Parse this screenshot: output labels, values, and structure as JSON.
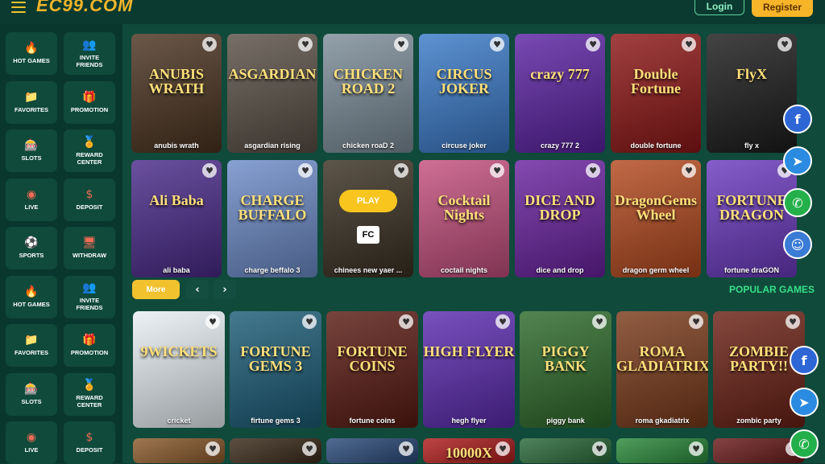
{
  "header": {
    "logo_text": "EC99.COM",
    "login_label": "Login",
    "register_label": "Register"
  },
  "sidebar": {
    "items": [
      {
        "label": "HOT GAMES",
        "icon": "fire-icon",
        "glyph": "🔥"
      },
      {
        "label": "INVITE FRIENDS",
        "icon": "users-icon",
        "glyph": "👥"
      },
      {
        "label": "FAVORITES",
        "icon": "folder-icon",
        "glyph": "📁"
      },
      {
        "label": "PROMOTION",
        "icon": "gift-icon",
        "glyph": "🎁"
      },
      {
        "label": "SLOTS",
        "icon": "slot-machine-icon",
        "glyph": "🎰"
      },
      {
        "label": "REWARD CENTER",
        "icon": "medal-icon",
        "glyph": "🏅"
      },
      {
        "label": "LIVE",
        "icon": "live-icon",
        "glyph": "◉"
      },
      {
        "label": "DEPOSIT",
        "icon": "dollar-icon",
        "glyph": "$"
      },
      {
        "label": "SPORTS",
        "icon": "sports-icon",
        "glyph": "⚽"
      },
      {
        "label": "WITHDRAW",
        "icon": "monitor-icon",
        "glyph": "🖥"
      },
      {
        "label": "HOT GAMES",
        "icon": "fire-icon",
        "glyph": "🔥"
      },
      {
        "label": "INVITE FRIENDS",
        "icon": "users-icon",
        "glyph": "👥"
      },
      {
        "label": "FAVORITES",
        "icon": "folder-icon",
        "glyph": "📁"
      },
      {
        "label": "PROMOTION",
        "icon": "gift-icon",
        "glyph": "🎁"
      },
      {
        "label": "SLOTS",
        "icon": "slot-machine-icon",
        "glyph": "🎰"
      },
      {
        "label": "REWARD CENTER",
        "icon": "medal-icon",
        "glyph": "🏅"
      },
      {
        "label": "LIVE",
        "icon": "live-icon",
        "glyph": "◉"
      },
      {
        "label": "DEPOSIT",
        "icon": "dollar-icon",
        "glyph": "$"
      }
    ]
  },
  "games_row1": [
    {
      "name": "anubis wrath",
      "art": "ANUBIS WRATH",
      "bg": "#4a3320"
    },
    {
      "name": "asgardian rising",
      "art": "ASGARDIAN",
      "bg": "#5a5046"
    },
    {
      "name": "chicken roaD 2",
      "art": "CHICKEN ROAD 2",
      "bg": "#7c8d99"
    },
    {
      "name": "circuse joker",
      "art": "CIRCUS JOKER",
      "bg": "#3a7ac9"
    },
    {
      "name": "crazy 777 2",
      "art": "crazy 777",
      "bg": "#5b22a3"
    },
    {
      "name": "double fortune",
      "art": "Double Fortune",
      "bg": "#8e1616"
    },
    {
      "name": "fly x",
      "art": "FlyX",
      "bg": "#1b1b1b"
    }
  ],
  "games_row2": [
    {
      "name": "ali baba",
      "art": "Ali Baba",
      "bg": "#4a2a8a"
    },
    {
      "name": "charge beffalo 3",
      "art": "CHARGE BUFFALO",
      "bg": "#6d8cc9"
    },
    {
      "name": "chinees new yaer ...",
      "art": "",
      "bg": "#3a3022",
      "play": "PLAY",
      "badge": "FC"
    },
    {
      "name": "coctail nights",
      "art": "Cocktail Nights",
      "bg": "#c44f7d"
    },
    {
      "name": "dice and drop",
      "art": "DICE AND DROP",
      "bg": "#6a22a0"
    },
    {
      "name": "dragon germ wheel",
      "art": "DragonGems Wheel",
      "bg": "#b4491e"
    },
    {
      "name": "fortune draGON",
      "art": "FORTUNE DRAGON",
      "bg": "#6b3ac0"
    }
  ],
  "controls": {
    "more_label": "More",
    "prev_glyph": "‹",
    "next_glyph": "›"
  },
  "section": {
    "popular_title": "POPULAR GAMES"
  },
  "games_row3": [
    {
      "name": "cricket",
      "art": "9WICKETS",
      "bg": "#e8f0f4"
    },
    {
      "name": "firtune gems 3",
      "art": "FORTUNE GEMS 3",
      "bg": "#1b5c77"
    },
    {
      "name": "fortune coins",
      "art": "FORTUNE COINS",
      "bg": "#5a1a12"
    },
    {
      "name": "hegh flyer",
      "art": "HIGH FLYER",
      "bg": "#5b2bb0"
    },
    {
      "name": "piggy bank",
      "art": "PIGGY BANK",
      "bg": "#2d6a2a"
    },
    {
      "name": "roma gkadiatrix",
      "art": "ROMA GLADIATRIX",
      "bg": "#7a3a1a"
    },
    {
      "name": "zombic party",
      "art": "ZOMBIE PARTY!!",
      "bg": "#6a2014"
    }
  ],
  "games_row4": [
    {
      "bg": "#8b5a2b"
    },
    {
      "bg": "#3a2a1a"
    },
    {
      "bg": "#2a4a7a"
    },
    {
      "bg": "#b01c1c",
      "art": "10000X"
    },
    {
      "bg": "#2a6a3a"
    },
    {
      "bg": "#2a8a3a"
    },
    {
      "bg": "#6a1a1a"
    }
  ],
  "social": {
    "facebook": "f",
    "telegram": "➤",
    "whatsapp": "✆",
    "support": "☺"
  }
}
